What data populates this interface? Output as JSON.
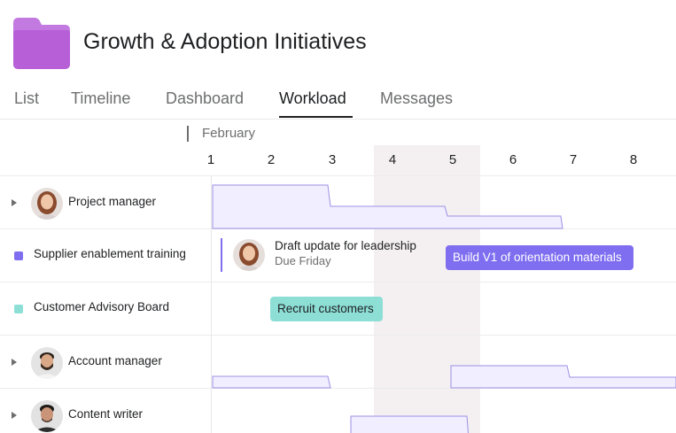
{
  "project": {
    "title": "Growth & Adoption Initiatives",
    "icon": "folder-icon",
    "icon_color": "#b65fd6"
  },
  "tabs": [
    {
      "label": "List",
      "active": false
    },
    {
      "label": "Timeline",
      "active": false
    },
    {
      "label": "Dashboard",
      "active": false
    },
    {
      "label": "Workload",
      "active": true
    },
    {
      "label": "Messages",
      "active": false
    }
  ],
  "timeline": {
    "month": "February",
    "days": [
      "1",
      "2",
      "3",
      "4",
      "5",
      "6",
      "7",
      "8"
    ],
    "highlighted_days": [
      "4",
      "5"
    ]
  },
  "rows": [
    {
      "type": "person",
      "label": "Project manager",
      "avatar": "avatar-woman"
    },
    {
      "type": "project",
      "label": "Supplier enablement training",
      "color": "#7f6ef0"
    },
    {
      "type": "project",
      "label": "Customer Advisory Board",
      "color": "#8ddfd6"
    },
    {
      "type": "person",
      "label": "Account manager",
      "avatar": "avatar-man-beard"
    },
    {
      "type": "person",
      "label": "Content writer",
      "avatar": "avatar-man"
    }
  ],
  "tasks": {
    "draft": {
      "title": "Draft update for leadership",
      "due": "Due Friday"
    },
    "build": {
      "label": "Build V1 of orientation materials"
    },
    "recruit": {
      "label": "Recruit customers"
    }
  },
  "colors": {
    "accent_purple": "#7f6ef0",
    "accent_teal": "#8ddfd6",
    "workload_fill": "#f1efff",
    "workload_stroke": "#9c8fe6",
    "weekend_highlight": "#f4f0f1"
  }
}
